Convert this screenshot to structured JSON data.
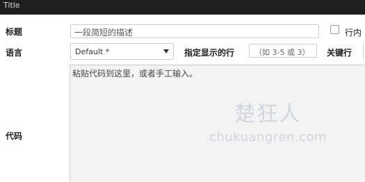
{
  "titlebar": {
    "title": "Title"
  },
  "form": {
    "title_label": "标题",
    "title_placeholder": "一段简短的描述",
    "inline_label": "行内",
    "language_label": "语言",
    "language_value": "Default *",
    "lines_label": "指定显示的行",
    "lines_placeholder": "（如 3-5 或 3）",
    "keyline_label": "关键行",
    "code_label": "代码",
    "code_placeholder": "粘贴代码到这里，或者手工输入。"
  },
  "watermark": {
    "chinese": "楚狂人",
    "url": "chukuangren.com"
  },
  "icons": {
    "select_caret": "caret-down-icon"
  }
}
